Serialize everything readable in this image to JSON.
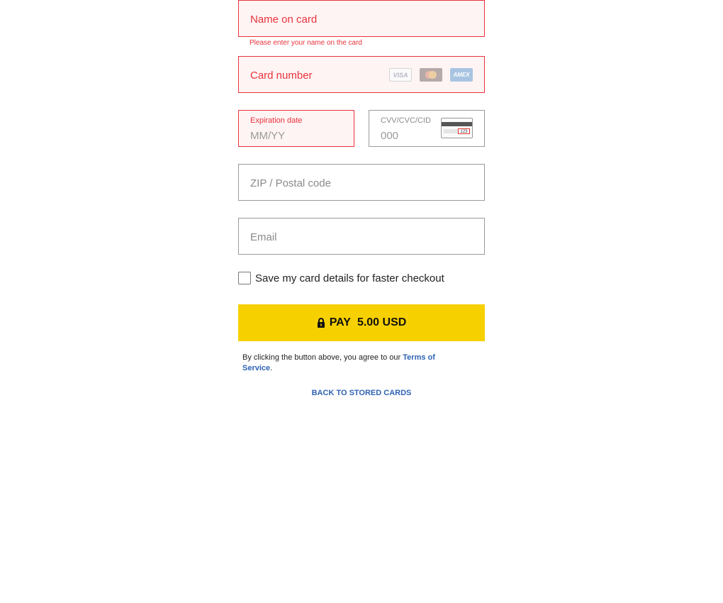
{
  "name_field": {
    "placeholder": "Name on card",
    "error": "Please enter your name on the card"
  },
  "card_number_field": {
    "placeholder": "Card number",
    "logos": [
      {
        "name": "visa",
        "label": "VISA"
      },
      {
        "name": "mastercard",
        "label": ""
      },
      {
        "name": "amex",
        "label": "AMEX"
      }
    ]
  },
  "expiration_field": {
    "label": "Expiration date",
    "placeholder": "MM/YY"
  },
  "cvv_field": {
    "label": "CVV/CVC/CID",
    "placeholder": "000",
    "card_code": "123"
  },
  "zip_field": {
    "placeholder": "ZIP / Postal code"
  },
  "email_field": {
    "placeholder": "Email"
  },
  "save_card": {
    "label": "Save my card details for faster checkout",
    "checked": false
  },
  "pay_button": {
    "label": "PAY",
    "amount": "5.00 USD"
  },
  "terms": {
    "prefix": "By clicking the button above, you agree to our ",
    "link": "Terms of Service",
    "suffix": "."
  },
  "back_link": "BACK TO STORED CARDS",
  "colors": {
    "error": "#e8323c",
    "pay_button": "#f7d000",
    "link": "#2f63b4"
  }
}
